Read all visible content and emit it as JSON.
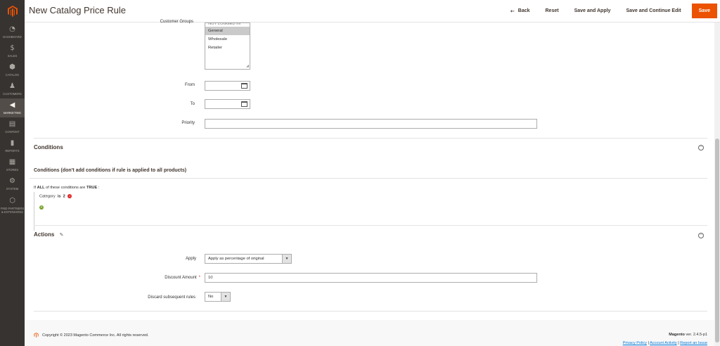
{
  "sidebar": {
    "items": [
      {
        "label": "Dashboard",
        "icon": "dashboard-icon"
      },
      {
        "label": "Sales",
        "icon": "dollar-icon"
      },
      {
        "label": "Catalog",
        "icon": "box-icon"
      },
      {
        "label": "Customers",
        "icon": "person-icon"
      },
      {
        "label": "Marketing",
        "icon": "megaphone-icon"
      },
      {
        "label": "Content",
        "icon": "layout-icon"
      },
      {
        "label": "Reports",
        "icon": "bar-chart-icon"
      },
      {
        "label": "Stores",
        "icon": "store-icon"
      },
      {
        "label": "System",
        "icon": "gear-icon"
      },
      {
        "label": "Find Partners & Extensions",
        "icon": "puzzle-icon"
      }
    ]
  },
  "header": {
    "title": "New Catalog Price Rule",
    "back": "Back",
    "reset": "Reset",
    "save_apply": "Save and Apply",
    "save_continue": "Save and Continue Edit",
    "save": "Save"
  },
  "form": {
    "customer_groups_label": "Customer Groups",
    "customer_groups": [
      "NOT LOGGED IN",
      "General",
      "Wholesale",
      "Retailer"
    ],
    "from_label": "From",
    "to_label": "To",
    "priority_label": "Priority"
  },
  "conditions": {
    "title": "Conditions",
    "subtitle": "Conditions (don't add conditions if rule is applied to all products)",
    "if": "If",
    "all": "ALL",
    "mid": "of these conditions are",
    "true": "TRUE",
    "colon": ":",
    "rule_attr": "Category",
    "rule_op": "is",
    "rule_val": "2"
  },
  "actions": {
    "title": "Actions",
    "apply_label": "Apply",
    "apply_value": "Apply as percentage of original",
    "discount_label": "Discount Amount",
    "discount_value": "10",
    "discard_label": "Discard subsequent rules",
    "discard_value": "No"
  },
  "footer": {
    "copyright": "Copyright © 2023 Magento Commerce Inc. All rights reserved.",
    "brand": "Magento",
    "version": "ver. 2.4.5-p1",
    "privacy": "Privacy Policy",
    "activity": "Account Activity",
    "report": "Report an Issue",
    "sep": "|"
  },
  "colors": {
    "accent": "#eb5202",
    "sidebar": "#373330",
    "link": "#007bdb"
  }
}
